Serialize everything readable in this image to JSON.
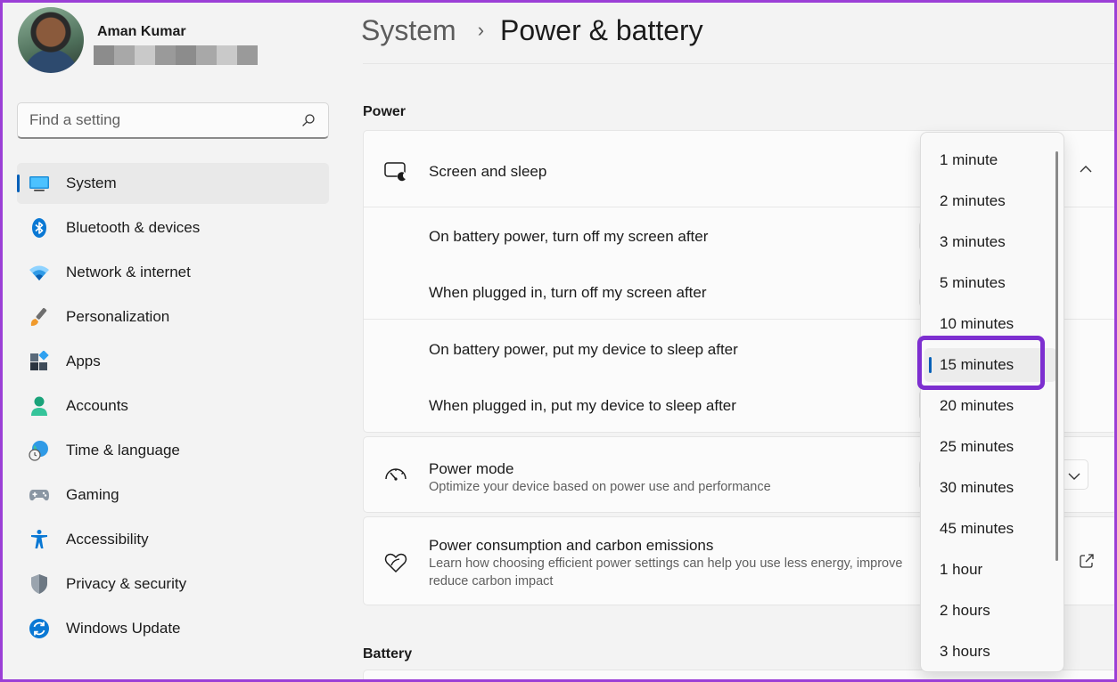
{
  "user": {
    "name": "Aman Kumar"
  },
  "search": {
    "placeholder": "Find a setting"
  },
  "nav": {
    "items": [
      {
        "label": "System",
        "icon": "monitor-icon"
      },
      {
        "label": "Bluetooth & devices",
        "icon": "bluetooth-icon"
      },
      {
        "label": "Network & internet",
        "icon": "wifi-icon"
      },
      {
        "label": "Personalization",
        "icon": "brush-icon"
      },
      {
        "label": "Apps",
        "icon": "apps-icon"
      },
      {
        "label": "Accounts",
        "icon": "person-icon"
      },
      {
        "label": "Time & language",
        "icon": "globe-clock-icon"
      },
      {
        "label": "Gaming",
        "icon": "gamepad-icon"
      },
      {
        "label": "Accessibility",
        "icon": "accessibility-icon"
      },
      {
        "label": "Privacy & security",
        "icon": "shield-icon"
      },
      {
        "label": "Windows Update",
        "icon": "update-icon"
      }
    ],
    "active": "System"
  },
  "breadcrumb": {
    "parent": "System",
    "separator": "›",
    "current": "Power & battery"
  },
  "sections": {
    "power": "Power",
    "battery": "Battery"
  },
  "screen_sleep": {
    "title": "Screen and sleep",
    "rows": [
      "On battery power, turn off my screen after",
      "When plugged in, turn off my screen after",
      "On battery power, put my device to sleep after",
      "When plugged in, put my device to sleep after"
    ]
  },
  "power_mode": {
    "title": "Power mode",
    "subtitle": "Optimize your device based on power use and performance"
  },
  "power_consumption": {
    "title": "Power consumption and carbon emissions",
    "subtitle_line1": "Learn how choosing efficient power settings can help you use less energy, improve",
    "subtitle_line2": "reduce carbon impact"
  },
  "dropdown": {
    "options": [
      "1 minute",
      "2 minutes",
      "3 minutes",
      "5 minutes",
      "10 minutes",
      "15 minutes",
      "20 minutes",
      "25 minutes",
      "30 minutes",
      "45 minutes",
      "1 hour",
      "2 hours",
      "3 hours"
    ],
    "selected": "15 minutes"
  },
  "colors": {
    "accent": "#005fb8",
    "highlight": "#7d2fd0"
  }
}
